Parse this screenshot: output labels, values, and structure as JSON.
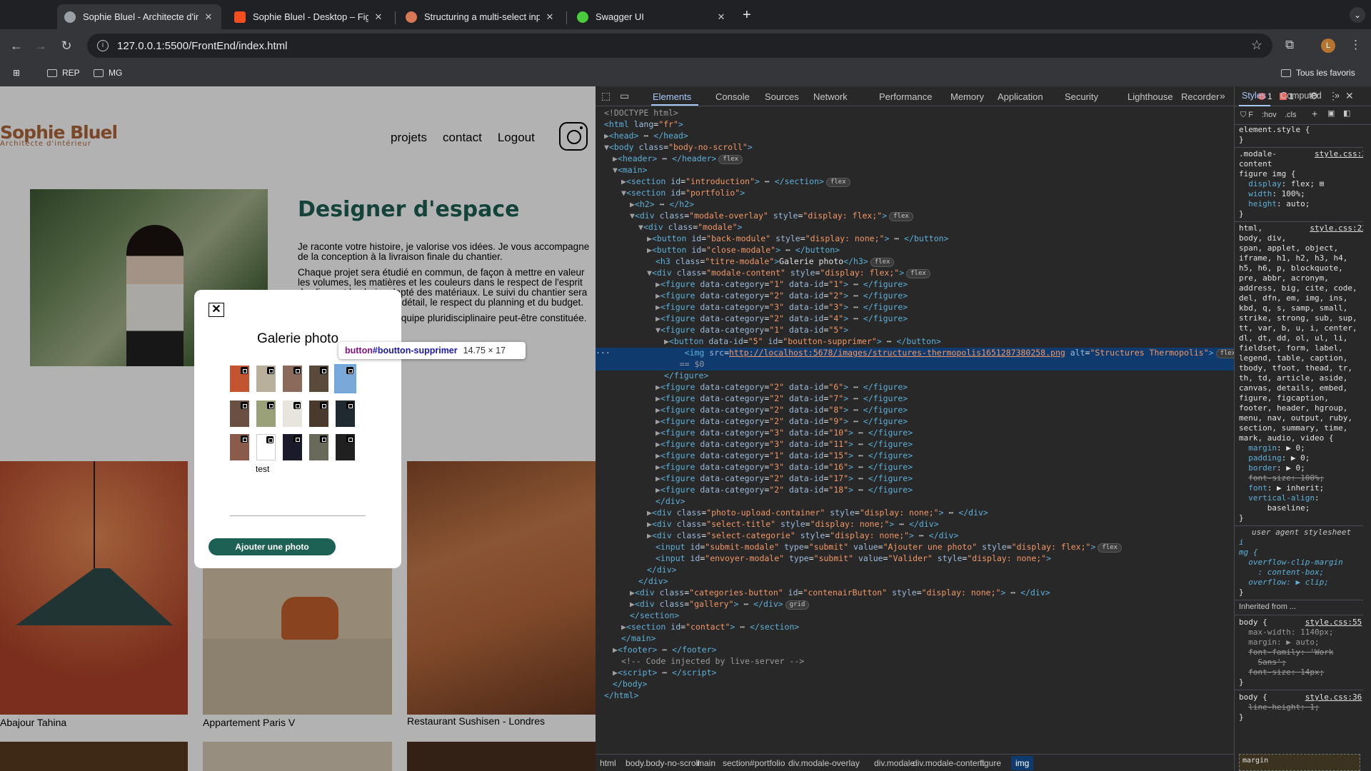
{
  "browser": {
    "tabs": [
      {
        "title": "Sophie Bluel - Architecte d'in",
        "fav": "#5f6368",
        "active": true
      },
      {
        "title": "Sophie Bluel - Desktop – Figr",
        "fav": "#f24e1e",
        "active": false
      },
      {
        "title": "Structuring a multi-select inp",
        "fav": "#d97757",
        "active": false
      },
      {
        "title": "Swagger UI",
        "fav": "#49cc3c",
        "active": false
      }
    ],
    "url": "127.0.0.1:5500/FrontEnd/index.html",
    "avatar_letter": "L",
    "bookmarks": [
      "REP",
      "MG"
    ],
    "all_bookmarks": "Tous les favoris"
  },
  "site": {
    "logo_name": "Sophie Bluel",
    "logo_sub": "Architecte d'intérieur",
    "menu": [
      "projets",
      "contact",
      "Logout"
    ],
    "intro_title": "Designer d'espace",
    "intro_paragraphs": [
      "Je raconte votre histoire, je valorise vos idées. Je vous accompagne de la conception à la livraison finale du chantier.",
      "Chaque projet sera étudié en commun, de façon à mettre en valeur les volumes, les matières et les couleurs dans le respect de l'esprit des lieux et le choix adapté des matériaux. Le suivi du chantier sera assuré dans le souci du détail, le respect du planning et du budget.",
      "En cas de besoin, une équipe pluridisciplinaire peut-être constituée."
    ],
    "gallery_captions": [
      "Abajour Tahina",
      "Appartement Paris V",
      "Restaurant Sushisen - Londres"
    ]
  },
  "modal": {
    "close_label": "✕",
    "title": "Galerie photo",
    "test_label": "test",
    "add_button": "Ajouter une photo",
    "thumb_colors": [
      "#c4532f",
      "#b8b09a",
      "#8a6a5a",
      "#5a4a3a",
      "#7aa8d8",
      "#6a5040",
      "#9aa078",
      "#e8e4de",
      "#4a3a2c",
      "#1e2a30",
      "#8a5a4a",
      "#ffffff",
      "#1a1a2a",
      "#6a6a5a",
      "#202020"
    ]
  },
  "tooltip": {
    "tag": "button",
    "id": "#boutton-supprimer",
    "size": "14.75 × 17"
  },
  "devtools": {
    "tabs": [
      "Elements",
      "Console",
      "Sources",
      "Network",
      "Performance",
      "Memory",
      "Application",
      "Security",
      "Lighthouse",
      "Recorder"
    ],
    "errors": "1",
    "warnings": "1",
    "selected_src": "http://localhost:5678/images/structures-thermopolis1651287380258.png",
    "breadcrumbs": [
      "html",
      "body.body-no-scroll",
      "main",
      "section#portfolio",
      "div.modale-overlay",
      "div.modale",
      "div.modale-content",
      "figure",
      "img"
    ],
    "styles_tabs": [
      "Styles",
      "Computed"
    ],
    "filter_hov": ":hov",
    "filter_cls": ".cls",
    "user_agent": "user agent stylesheet",
    "inherited": "Inherited from ...",
    "margin_label": "margin"
  }
}
